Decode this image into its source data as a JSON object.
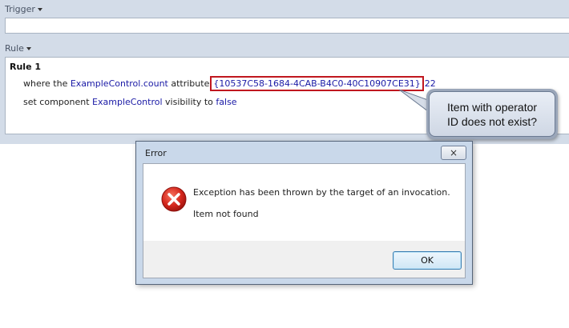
{
  "trigger": {
    "label": "Trigger",
    "value": ""
  },
  "rule_section": {
    "label": "Rule",
    "rule_title": "Rule 1",
    "line1": {
      "prefix": "where the",
      "control": "ExampleControl.count",
      "word": "attribute",
      "guid": "{10537C58-1684-4CAB-B4C0-40C10907CE31}",
      "value": "22"
    },
    "line2": {
      "prefix": "set component",
      "control": "ExampleControl",
      "word": "visibility to",
      "value": "false"
    }
  },
  "callout": {
    "line1": "Item with operator",
    "line2": "ID does not exist?"
  },
  "dialog": {
    "title": "Error",
    "close_label": "×",
    "icon": "error-icon",
    "message": "Exception has been thrown by the target of an invocation.",
    "detail": "Item not found",
    "ok_label": "OK"
  },
  "colors": {
    "keyword": "#1a1aa6",
    "highlight": "#c0171f",
    "editor_bg": "#d3dce8"
  }
}
